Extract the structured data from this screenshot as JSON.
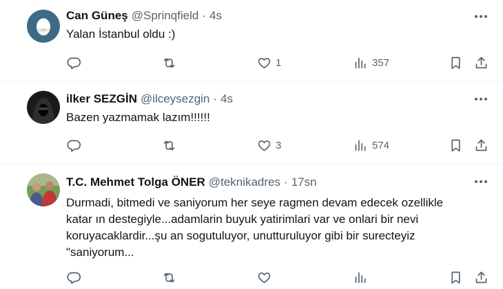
{
  "tweets": [
    {
      "name": "Can Güneş",
      "handle": "@Sprinqfield",
      "separator": "·",
      "time": "4s",
      "text_lines": [
        "Yalan İstanbul oldu :)"
      ],
      "replies": "",
      "retweets": "",
      "likes": "1",
      "views": "357",
      "avatar_icon": "white-egg-avatar"
    },
    {
      "name": "ilker SEZGİN",
      "handle": "@ilceysezgin",
      "separator": "·",
      "time": "4s",
      "text_lines": [
        "Bazen yazmamak lazım!!!!!!"
      ],
      "replies": "",
      "retweets": "",
      "likes": "3",
      "views": "574",
      "avatar_icon": "hooded-figure-avatar"
    },
    {
      "name": "T.C. Mehmet Tolga ÖNER",
      "handle": "@teknikadres",
      "separator": "·",
      "time": "17sn",
      "text_lines": [
        "Durmadi, bitmedi ve saniyorum her seye ragmen devam edecek ozellikle",
        "katar ın destegiyle...adamlarin buyuk yatirimlari var ve onlari bir nevi",
        "koruyacaklardir...şu an sogutuluyor, unutturuluyor gibi bir surecteyiz",
        "\"saniyorum..."
      ],
      "replies": "",
      "retweets": "",
      "likes": "",
      "views": "",
      "avatar_icon": "person-photo-avatar"
    }
  ],
  "colors": {
    "text": "#0f1419",
    "secondary": "#536471",
    "divider": "#eff3f4"
  }
}
